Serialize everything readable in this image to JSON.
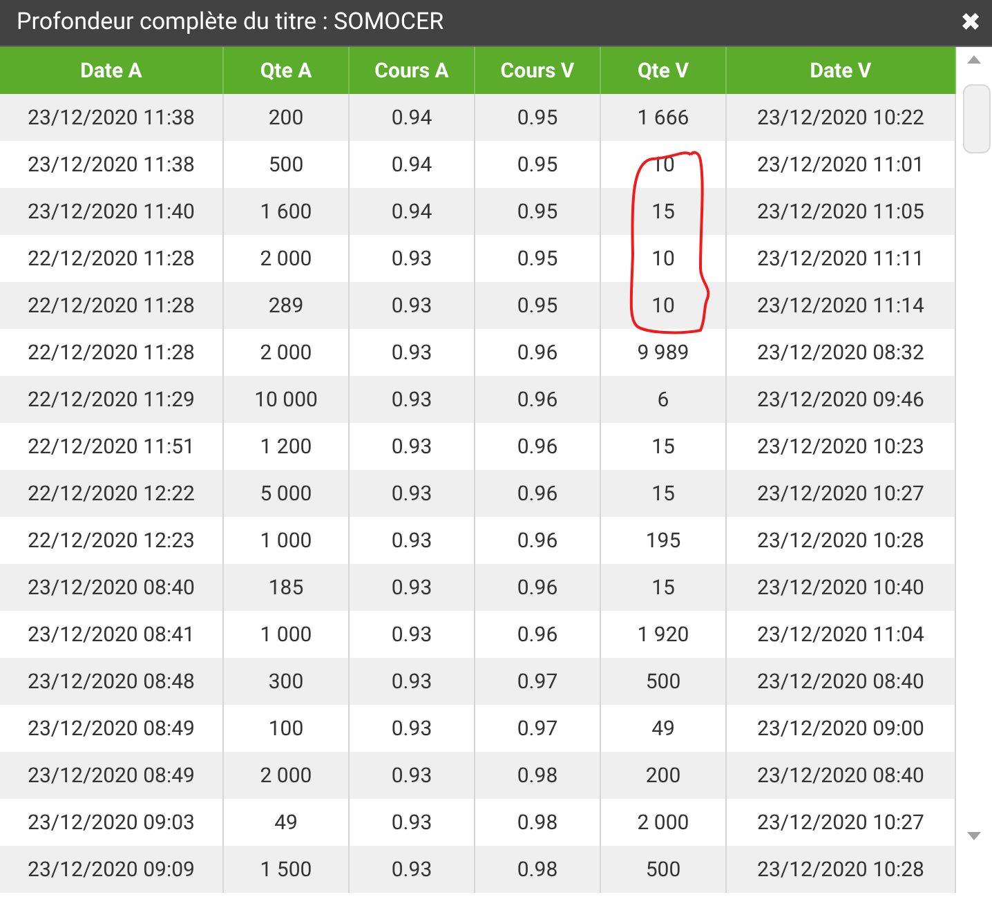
{
  "window": {
    "title": "Profondeur complète du titre : SOMOCER",
    "close": "✖"
  },
  "table": {
    "columns": [
      "Date A",
      "Qte A",
      "Cours A",
      "Cours V",
      "Qte V",
      "Date V"
    ],
    "rows": [
      [
        "23/12/2020 11:38",
        "200",
        "0.94",
        "0.95",
        "1 666",
        "23/12/2020 10:22"
      ],
      [
        "23/12/2020 11:38",
        "500",
        "0.94",
        "0.95",
        "10",
        "23/12/2020 11:01"
      ],
      [
        "23/12/2020 11:40",
        "1 600",
        "0.94",
        "0.95",
        "15",
        "23/12/2020 11:05"
      ],
      [
        "22/12/2020 11:28",
        "2 000",
        "0.93",
        "0.95",
        "10",
        "23/12/2020 11:11"
      ],
      [
        "22/12/2020 11:28",
        "289",
        "0.93",
        "0.95",
        "10",
        "23/12/2020 11:14"
      ],
      [
        "22/12/2020 11:28",
        "2 000",
        "0.93",
        "0.96",
        "9 989",
        "23/12/2020 08:32"
      ],
      [
        "22/12/2020 11:29",
        "10 000",
        "0.93",
        "0.96",
        "6",
        "23/12/2020 09:46"
      ],
      [
        "22/12/2020 11:51",
        "1 200",
        "0.93",
        "0.96",
        "15",
        "23/12/2020 10:23"
      ],
      [
        "22/12/2020 12:22",
        "5 000",
        "0.93",
        "0.96",
        "15",
        "23/12/2020 10:27"
      ],
      [
        "22/12/2020 12:23",
        "1 000",
        "0.93",
        "0.96",
        "195",
        "23/12/2020 10:28"
      ],
      [
        "23/12/2020 08:40",
        "185",
        "0.93",
        "0.96",
        "15",
        "23/12/2020 10:40"
      ],
      [
        "23/12/2020 08:41",
        "1 000",
        "0.93",
        "0.96",
        "1 920",
        "23/12/2020 11:04"
      ],
      [
        "23/12/2020 08:48",
        "300",
        "0.93",
        "0.97",
        "500",
        "23/12/2020 08:40"
      ],
      [
        "23/12/2020 08:49",
        "100",
        "0.93",
        "0.97",
        "49",
        "23/12/2020 09:00"
      ],
      [
        "23/12/2020 08:49",
        "2 000",
        "0.93",
        "0.98",
        "200",
        "23/12/2020 08:40"
      ],
      [
        "23/12/2020 09:03",
        "49",
        "0.93",
        "0.98",
        "2 000",
        "23/12/2020 10:27"
      ],
      [
        "23/12/2020 09:09",
        "1 500",
        "0.93",
        "0.98",
        "500",
        "23/12/2020 10:28"
      ]
    ]
  }
}
